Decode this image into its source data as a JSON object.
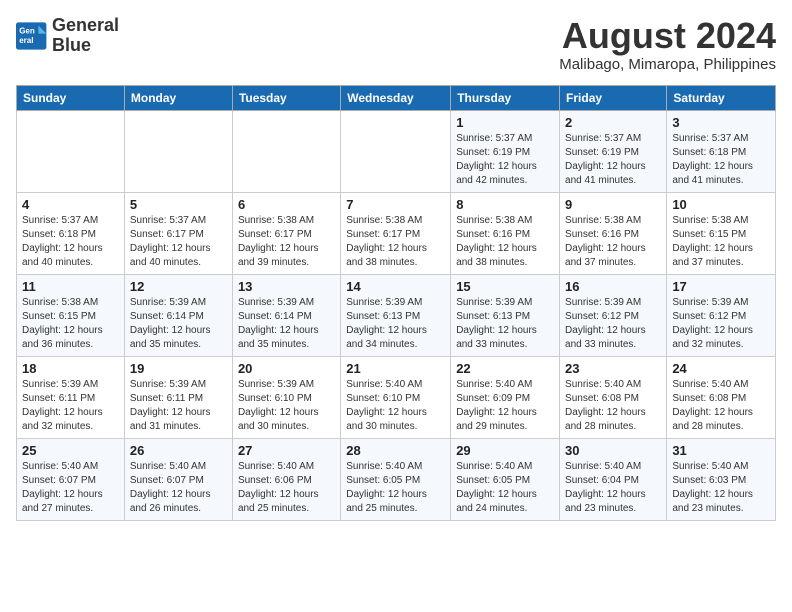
{
  "logo": {
    "line1": "General",
    "line2": "Blue"
  },
  "title": {
    "month_year": "August 2024",
    "location": "Malibago, Mimaropa, Philippines"
  },
  "headers": [
    "Sunday",
    "Monday",
    "Tuesday",
    "Wednesday",
    "Thursday",
    "Friday",
    "Saturday"
  ],
  "weeks": [
    [
      {
        "day": "",
        "info": ""
      },
      {
        "day": "",
        "info": ""
      },
      {
        "day": "",
        "info": ""
      },
      {
        "day": "",
        "info": ""
      },
      {
        "day": "1",
        "info": "Sunrise: 5:37 AM\nSunset: 6:19 PM\nDaylight: 12 hours\nand 42 minutes."
      },
      {
        "day": "2",
        "info": "Sunrise: 5:37 AM\nSunset: 6:19 PM\nDaylight: 12 hours\nand 41 minutes."
      },
      {
        "day": "3",
        "info": "Sunrise: 5:37 AM\nSunset: 6:18 PM\nDaylight: 12 hours\nand 41 minutes."
      }
    ],
    [
      {
        "day": "4",
        "info": "Sunrise: 5:37 AM\nSunset: 6:18 PM\nDaylight: 12 hours\nand 40 minutes."
      },
      {
        "day": "5",
        "info": "Sunrise: 5:37 AM\nSunset: 6:17 PM\nDaylight: 12 hours\nand 40 minutes."
      },
      {
        "day": "6",
        "info": "Sunrise: 5:38 AM\nSunset: 6:17 PM\nDaylight: 12 hours\nand 39 minutes."
      },
      {
        "day": "7",
        "info": "Sunrise: 5:38 AM\nSunset: 6:17 PM\nDaylight: 12 hours\nand 38 minutes."
      },
      {
        "day": "8",
        "info": "Sunrise: 5:38 AM\nSunset: 6:16 PM\nDaylight: 12 hours\nand 38 minutes."
      },
      {
        "day": "9",
        "info": "Sunrise: 5:38 AM\nSunset: 6:16 PM\nDaylight: 12 hours\nand 37 minutes."
      },
      {
        "day": "10",
        "info": "Sunrise: 5:38 AM\nSunset: 6:15 PM\nDaylight: 12 hours\nand 37 minutes."
      }
    ],
    [
      {
        "day": "11",
        "info": "Sunrise: 5:38 AM\nSunset: 6:15 PM\nDaylight: 12 hours\nand 36 minutes."
      },
      {
        "day": "12",
        "info": "Sunrise: 5:39 AM\nSunset: 6:14 PM\nDaylight: 12 hours\nand 35 minutes."
      },
      {
        "day": "13",
        "info": "Sunrise: 5:39 AM\nSunset: 6:14 PM\nDaylight: 12 hours\nand 35 minutes."
      },
      {
        "day": "14",
        "info": "Sunrise: 5:39 AM\nSunset: 6:13 PM\nDaylight: 12 hours\nand 34 minutes."
      },
      {
        "day": "15",
        "info": "Sunrise: 5:39 AM\nSunset: 6:13 PM\nDaylight: 12 hours\nand 33 minutes."
      },
      {
        "day": "16",
        "info": "Sunrise: 5:39 AM\nSunset: 6:12 PM\nDaylight: 12 hours\nand 33 minutes."
      },
      {
        "day": "17",
        "info": "Sunrise: 5:39 AM\nSunset: 6:12 PM\nDaylight: 12 hours\nand 32 minutes."
      }
    ],
    [
      {
        "day": "18",
        "info": "Sunrise: 5:39 AM\nSunset: 6:11 PM\nDaylight: 12 hours\nand 32 minutes."
      },
      {
        "day": "19",
        "info": "Sunrise: 5:39 AM\nSunset: 6:11 PM\nDaylight: 12 hours\nand 31 minutes."
      },
      {
        "day": "20",
        "info": "Sunrise: 5:39 AM\nSunset: 6:10 PM\nDaylight: 12 hours\nand 30 minutes."
      },
      {
        "day": "21",
        "info": "Sunrise: 5:40 AM\nSunset: 6:10 PM\nDaylight: 12 hours\nand 30 minutes."
      },
      {
        "day": "22",
        "info": "Sunrise: 5:40 AM\nSunset: 6:09 PM\nDaylight: 12 hours\nand 29 minutes."
      },
      {
        "day": "23",
        "info": "Sunrise: 5:40 AM\nSunset: 6:08 PM\nDaylight: 12 hours\nand 28 minutes."
      },
      {
        "day": "24",
        "info": "Sunrise: 5:40 AM\nSunset: 6:08 PM\nDaylight: 12 hours\nand 28 minutes."
      }
    ],
    [
      {
        "day": "25",
        "info": "Sunrise: 5:40 AM\nSunset: 6:07 PM\nDaylight: 12 hours\nand 27 minutes."
      },
      {
        "day": "26",
        "info": "Sunrise: 5:40 AM\nSunset: 6:07 PM\nDaylight: 12 hours\nand 26 minutes."
      },
      {
        "day": "27",
        "info": "Sunrise: 5:40 AM\nSunset: 6:06 PM\nDaylight: 12 hours\nand 25 minutes."
      },
      {
        "day": "28",
        "info": "Sunrise: 5:40 AM\nSunset: 6:05 PM\nDaylight: 12 hours\nand 25 minutes."
      },
      {
        "day": "29",
        "info": "Sunrise: 5:40 AM\nSunset: 6:05 PM\nDaylight: 12 hours\nand 24 minutes."
      },
      {
        "day": "30",
        "info": "Sunrise: 5:40 AM\nSunset: 6:04 PM\nDaylight: 12 hours\nand 23 minutes."
      },
      {
        "day": "31",
        "info": "Sunrise: 5:40 AM\nSunset: 6:03 PM\nDaylight: 12 hours\nand 23 minutes."
      }
    ]
  ]
}
